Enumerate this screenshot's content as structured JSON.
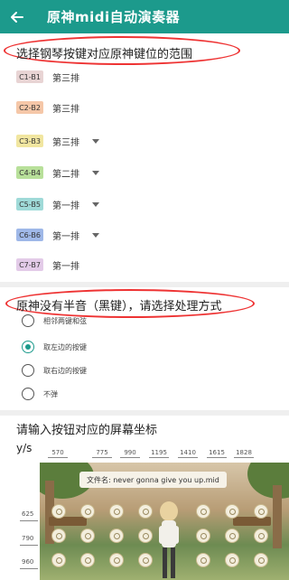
{
  "app_bar": {
    "title": "原神midi自动演奏器",
    "back_icon": "arrow-back-icon",
    "color": "#1c9a8c"
  },
  "range_section": {
    "title": "选择钢琴按键对应原神键位的范围",
    "rows": [
      {
        "range": "C1-B1",
        "label": "第三排",
        "color": "#e8d4d4",
        "dropdown": false
      },
      {
        "range": "C2-B2",
        "label": "第三排",
        "color": "#f5c7a8",
        "dropdown": false
      },
      {
        "range": "C3-B3",
        "label": "第三排",
        "color": "#f1e6a0",
        "dropdown": true
      },
      {
        "range": "C4-B4",
        "label": "第二排",
        "color": "#b8e09a",
        "dropdown": true
      },
      {
        "range": "C5-B5",
        "label": "第一排",
        "color": "#9fdad8",
        "dropdown": true
      },
      {
        "range": "C6-B6",
        "label": "第一排",
        "color": "#9fb8e8",
        "dropdown": true
      },
      {
        "range": "C7-B7",
        "label": "第一排",
        "color": "#e3cbe8",
        "dropdown": false
      }
    ]
  },
  "semitone_section": {
    "title": "原神没有半音（黑键），请选择处理方式",
    "options": [
      {
        "label": "相邻两键和弦",
        "selected": false
      },
      {
        "label": "取左边的按键",
        "selected": true
      },
      {
        "label": "取右边的按键",
        "selected": false
      },
      {
        "label": "不弹",
        "selected": false
      }
    ]
  },
  "coords_section": {
    "title": "请输入按钮对应的屏幕坐标",
    "y_label": "y/s",
    "x_values": [
      "570",
      "775",
      "990",
      "1195",
      "1410",
      "1615",
      "1828"
    ],
    "y_values": [
      "625",
      "790",
      "960"
    ],
    "file_banner": "文件名: never gonna give you up.mid"
  }
}
